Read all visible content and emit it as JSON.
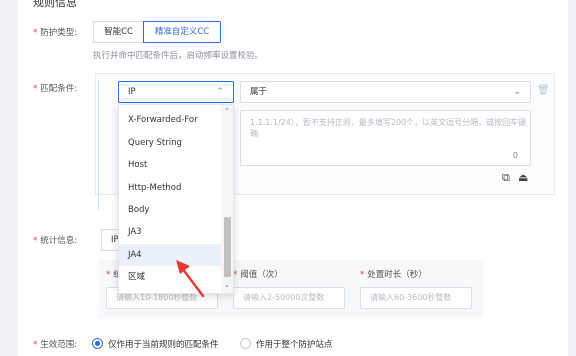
{
  "section": {
    "title": "规则信息"
  },
  "protection": {
    "label": "防护类型:",
    "options": [
      "智能CC",
      "精准自定义CC"
    ],
    "hint": "执行并命中匹配条件后，启动频率设置校验。"
  },
  "match": {
    "label": "匹配条件:",
    "field_value": "IP",
    "operator_value": "属于",
    "textarea_placeholder": "1.1.1.1/24），暂不支持正则，最多填写200个，以英文逗号分隔，或按回车键确",
    "char_count": "0",
    "field_options": [
      "X-Forwarded-For",
      "Query String",
      "Host",
      "Http-Method",
      "Body",
      "JA3",
      "JA4",
      "区域"
    ],
    "selected_option_index": 6
  },
  "stats": {
    "label": "统计信息:",
    "value": "IP",
    "fields": [
      {
        "label": "统",
        "placeholder": "请输入10-1800秒整数"
      },
      {
        "label": "阈值（次）",
        "placeholder": "请输入2-50000次整数"
      },
      {
        "label": "处置时长（秒）",
        "placeholder": "请输入60-3600秒整数"
      }
    ]
  },
  "scope": {
    "label": "生效范围:",
    "options": [
      "仅作用于当前规则的匹配条件",
      "作用于整个防护站点"
    ],
    "selected_index": 0
  },
  "colors": {
    "accent": "#2f6cf6",
    "required": "#e53935",
    "annotation_arrow": "#e53935"
  }
}
